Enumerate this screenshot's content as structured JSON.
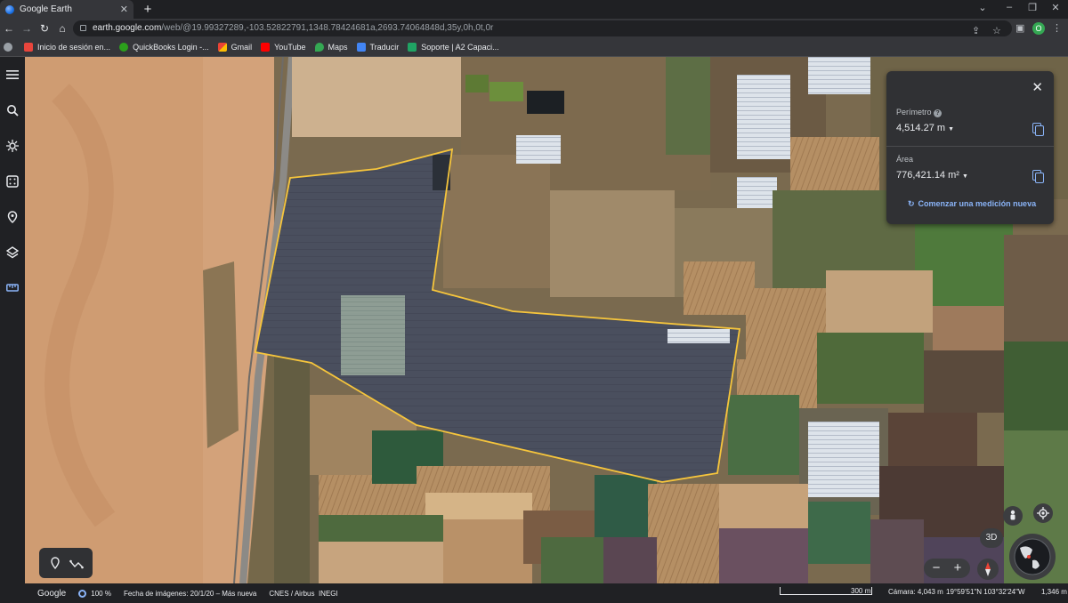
{
  "browser": {
    "tab_title": "Google Earth",
    "tab_close": "✕",
    "new_tab": "+",
    "window_controls": [
      "⌄",
      "–",
      "❐",
      "✕"
    ],
    "url_host": "earth.google.com",
    "url_path": "/web/@19.99327289,-103.52822791,1348.78424681a,2693.74064848d,35y,0h,0t,0r",
    "profile_initial": "O",
    "nav": {
      "back": "←",
      "forward": "→",
      "reload": "↻",
      "home": "⌂"
    }
  },
  "bookmarks": [
    {
      "label": "Inicio de sesión en...",
      "icon": "intuit-icon",
      "color": "#e8453c"
    },
    {
      "label": "QuickBooks Login -...",
      "icon": "quickbooks-icon",
      "color": "#2ca01c"
    },
    {
      "label": "Gmail",
      "icon": "gmail-icon",
      "color": "#ea4335"
    },
    {
      "label": "YouTube",
      "icon": "youtube-icon",
      "color": "#ff0000"
    },
    {
      "label": "Maps",
      "icon": "maps-icon",
      "color": "#34a853"
    },
    {
      "label": "Traducir",
      "icon": "translate-icon",
      "color": "#4285f4"
    },
    {
      "label": "Soporte | A2 Capaci...",
      "icon": "a2-icon",
      "color": "#20a464"
    }
  ],
  "measurement": {
    "perimeter_label": "Perímetro",
    "perimeter_value": "4,514.27 m",
    "area_label": "Área",
    "area_value": "776,421.14 m²",
    "new_measurement": "Comenzar una medición nueva",
    "close": "✕"
  },
  "map_controls": {
    "threed": "3D",
    "zoom_out": "−",
    "zoom_in": "+"
  },
  "status_bar": {
    "brand": "Google",
    "zoom": "100 %",
    "imagery_date": "Fecha de imágenes: 20/1/20 – Más nueva",
    "attribution": "CNES / Airbus  INEGI",
    "scale": "300 m",
    "camera": "Cámara: 4,043 m",
    "coords": "19°59'51\"N 103°32'24\"W",
    "elevation": "1,346 m"
  },
  "colors": {
    "accent": "#8ab4f8",
    "measure_outline": "#f6c53c"
  }
}
